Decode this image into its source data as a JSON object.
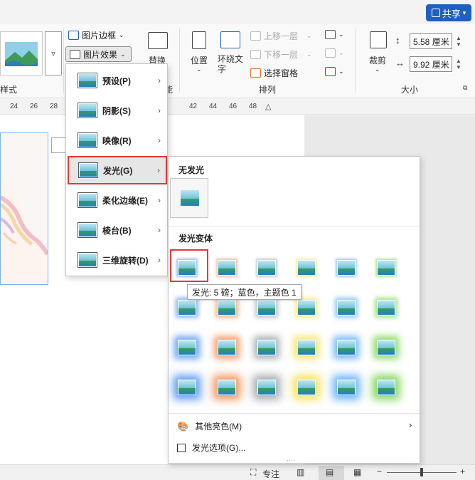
{
  "ribbon": {
    "share_label": "共享",
    "styles_group_label": "样式",
    "picture_border": "图片边框",
    "picture_effects": "图片效果",
    "replace": "替换",
    "replace_group_partial": "能",
    "position": "位置",
    "wrap_text": "环绕文字",
    "bring_forward": "上移一层",
    "send_backward": "下移一层",
    "selection_pane": "选择窗格",
    "arrange_group_label": "排列",
    "crop": "裁剪",
    "height_value": "5.58 厘米",
    "width_value": "9.92 厘米",
    "size_group_label": "大小"
  },
  "ruler": {
    "left_numbers": [
      "24",
      "26",
      "28"
    ],
    "right_numbers": [
      "42",
      "44",
      "46",
      "48"
    ]
  },
  "effects_menu": {
    "items": [
      {
        "label": "预设(P)"
      },
      {
        "label": "阴影(S)"
      },
      {
        "label": "映像(R)"
      },
      {
        "label": "发光(G)"
      },
      {
        "label": "柔化边缘(E)"
      },
      {
        "label": "棱台(B)"
      },
      {
        "label": "三维旋转(D)"
      }
    ],
    "active_item": "发光(G)"
  },
  "glow_submenu": {
    "no_glow_title": "无发光",
    "variants_title": "发光变体",
    "color_columns": [
      "#4a8ef0",
      "#f0884a",
      "#9aa0a8",
      "#f5e04a",
      "#5aa8f5",
      "#74d24a"
    ],
    "rows": 4,
    "selected": "row 1, col 1",
    "tooltip": "发光: 5 磅；蓝色，主题色 1",
    "more_colors": "其他亮色(M)",
    "glow_options": "发光选项(G)..."
  },
  "status_bar": {
    "focus_label": "专注",
    "zoom_minus": "−",
    "zoom_plus": "+",
    "zoom_fraction": 0.5
  }
}
